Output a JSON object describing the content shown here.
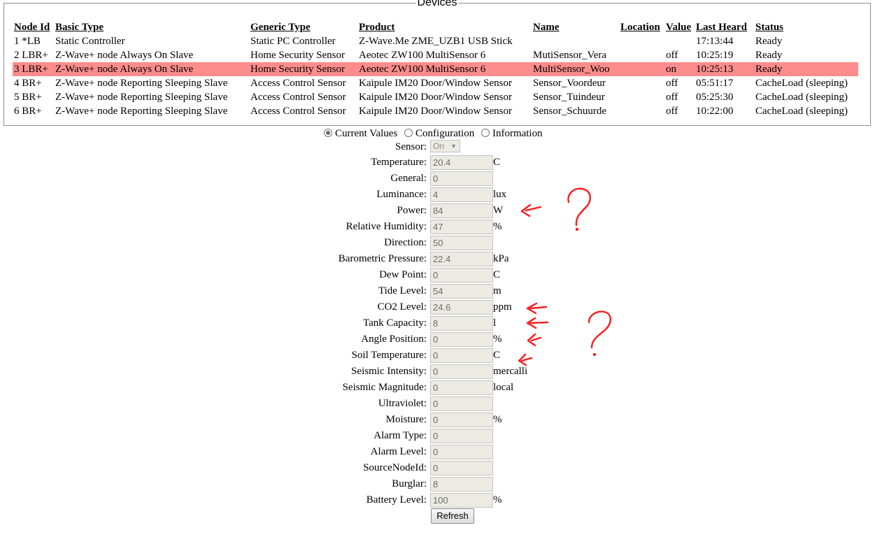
{
  "devices": {
    "legend": "Devices",
    "columns": [
      "Node Id",
      "Basic Type",
      "Generic Type",
      "Product",
      "Name",
      "Location",
      "Value",
      "Last Heard",
      "Status"
    ],
    "rows": [
      {
        "node": "1 *LB",
        "basic": "Static Controller",
        "generic": "Static PC Controller",
        "product": "Z-Wave.Me ZME_UZB1 USB Stick",
        "name": "",
        "location": "",
        "value": "",
        "last_heard": "17:13:44",
        "status": "Ready"
      },
      {
        "node": "2 LBR+",
        "basic": "Z-Wave+ node Always On Slave",
        "generic": "Home Security Sensor",
        "product": "Aeotec ZW100 MultiSensor 6",
        "name": "MutiSensor_Vera",
        "location": "",
        "value": "off",
        "last_heard": "10:25:19",
        "status": "Ready"
      },
      {
        "node": "3 LBR+",
        "basic": "Z-Wave+ node Always On Slave",
        "generic": "Home Security Sensor",
        "product": "Aeotec ZW100 MultiSensor 6",
        "name": "MultiSensor_Woo",
        "location": "",
        "value": "on",
        "last_heard": "10:25:13",
        "status": "Ready"
      },
      {
        "node": "4 BR+",
        "basic": "Z-Wave+ node Reporting Sleeping Slave",
        "generic": "Access Control Sensor",
        "product": "Kaipule IM20 Door/Window Sensor",
        "name": "Sensor_Voordeur",
        "location": "",
        "value": "off",
        "last_heard": "05:51:17",
        "status": "CacheLoad (sleeping)"
      },
      {
        "node": "5 BR+",
        "basic": "Z-Wave+ node Reporting Sleeping Slave",
        "generic": "Access Control Sensor",
        "product": "Kaipule IM20 Door/Window Sensor",
        "name": "Sensor_Tuindeur",
        "location": "",
        "value": "off",
        "last_heard": "05:25:30",
        "status": "CacheLoad (sleeping)"
      },
      {
        "node": "6 BR+",
        "basic": "Z-Wave+ node Reporting Sleeping Slave",
        "generic": "Access Control Sensor",
        "product": "Kaipule IM20 Door/Window Sensor",
        "name": "Sensor_Schuurde",
        "location": "",
        "value": "off",
        "last_heard": "10:22:00",
        "status": "CacheLoad (sleeping)"
      }
    ],
    "selected_row_color": "#fd8c8c"
  },
  "tabs": [
    {
      "label": "Current Values",
      "checked": true
    },
    {
      "label": "Configuration",
      "checked": false
    },
    {
      "label": "Information",
      "checked": false
    }
  ],
  "form": {
    "sensor": {
      "label": "Sensor:",
      "value": "On"
    },
    "fields": [
      {
        "label": "Temperature:",
        "value": "20.4",
        "unit": "C"
      },
      {
        "label": "General:",
        "value": "0",
        "unit": ""
      },
      {
        "label": "Luminance:",
        "value": "4",
        "unit": "lux"
      },
      {
        "label": "Power:",
        "value": "84",
        "unit": "W"
      },
      {
        "label": "Relative Humidity:",
        "value": "47",
        "unit": "%"
      },
      {
        "label": "Direction:",
        "value": "50",
        "unit": ""
      },
      {
        "label": "Barometric Pressure:",
        "value": "22.4",
        "unit": "kPa"
      },
      {
        "label": "Dew Point:",
        "value": "0",
        "unit": "C"
      },
      {
        "label": "Tide Level:",
        "value": "54",
        "unit": "m"
      },
      {
        "label": "CO2 Level:",
        "value": "24.6",
        "unit": "ppm"
      },
      {
        "label": "Tank Capacity:",
        "value": "8",
        "unit": "l"
      },
      {
        "label": "Angle Position:",
        "value": "0",
        "unit": "%"
      },
      {
        "label": "Soil Temperature:",
        "value": "0",
        "unit": "C"
      },
      {
        "label": "Seismic Intensity:",
        "value": "0",
        "unit": "mercalli"
      },
      {
        "label": "Seismic Magnitude:",
        "value": "0",
        "unit": "local"
      },
      {
        "label": "Ultraviolet:",
        "value": "0",
        "unit": ""
      },
      {
        "label": "Moisture:",
        "value": "0",
        "unit": "%"
      },
      {
        "label": "Alarm Type:",
        "value": "0",
        "unit": ""
      },
      {
        "label": "Alarm Level:",
        "value": "0",
        "unit": ""
      },
      {
        "label": "SourceNodeId:",
        "value": "0",
        "unit": ""
      },
      {
        "label": "Burglar:",
        "value": "8",
        "unit": ""
      },
      {
        "label": "Battery Level:",
        "value": "100",
        "unit": "%"
      }
    ],
    "refresh_label": "Refresh"
  },
  "annotations": {
    "color": "#ff1a1a",
    "marks": [
      "arrow-icon",
      "question-mark-icon"
    ]
  }
}
